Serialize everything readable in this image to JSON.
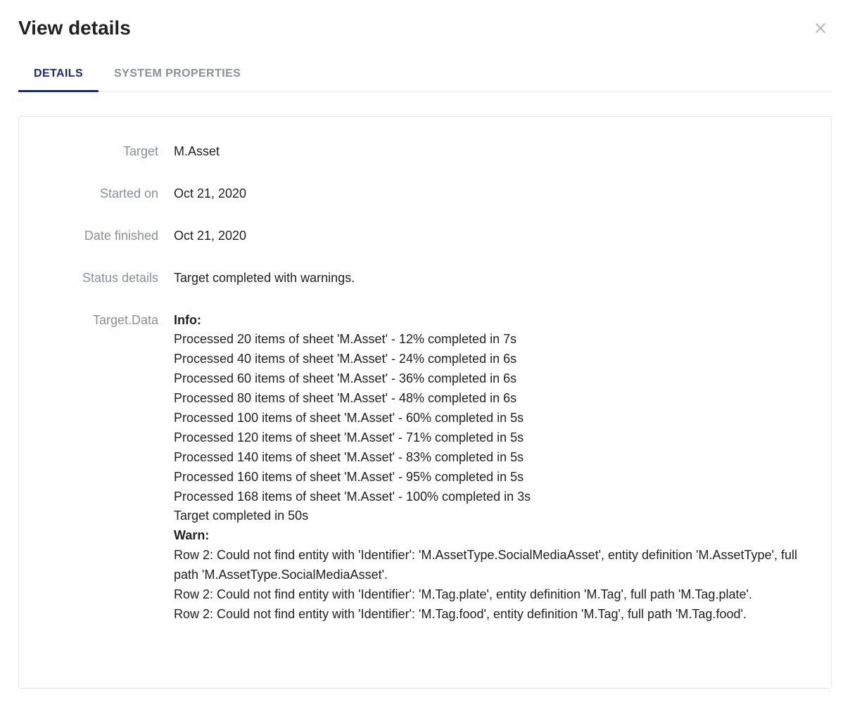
{
  "header": {
    "title": "View details"
  },
  "tabs": [
    {
      "label": "DETAILS",
      "active": true
    },
    {
      "label": "SYSTEM PROPERTIES",
      "active": false
    }
  ],
  "fields": {
    "target": {
      "label": "Target",
      "value": "M.Asset"
    },
    "started_on": {
      "label": "Started on",
      "value": "Oct 21, 2020"
    },
    "date_finished": {
      "label": "Date finished",
      "value": "Oct 21, 2020"
    },
    "status_details": {
      "label": "Status details",
      "value": "Target completed with warnings."
    },
    "target_data": {
      "label": "Target.Data",
      "info_heading": "Info:",
      "info_lines": [
        "Processed 20 items of sheet 'M.Asset' - 12% completed in 7s",
        "Processed 40 items of sheet 'M.Asset' - 24% completed in 6s",
        "Processed 60 items of sheet 'M.Asset' - 36% completed in 6s",
        "Processed 80 items of sheet 'M.Asset' - 48% completed in 6s",
        "Processed 100 items of sheet 'M.Asset' - 60% completed in 5s",
        "Processed 120 items of sheet 'M.Asset' - 71% completed in 5s",
        "Processed 140 items of sheet 'M.Asset' - 83% completed in 5s",
        "Processed 160 items of sheet 'M.Asset' - 95% completed in 5s",
        "Processed 168 items of sheet 'M.Asset' - 100% completed in 3s",
        "Target completed in 50s"
      ],
      "warn_heading": "Warn:",
      "warn_lines": [
        "Row 2: Could not find entity with 'Identifier': 'M.AssetType.SocialMediaAsset', entity definition 'M.AssetType', full path 'M.AssetType.SocialMediaAsset'.",
        "Row 2: Could not find entity with 'Identifier': 'M.Tag.plate', entity definition 'M.Tag', full path 'M.Tag.plate'.",
        "Row 2: Could not find entity with 'Identifier': 'M.Tag.food', entity definition 'M.Tag', full path 'M.Tag.food'."
      ]
    }
  }
}
